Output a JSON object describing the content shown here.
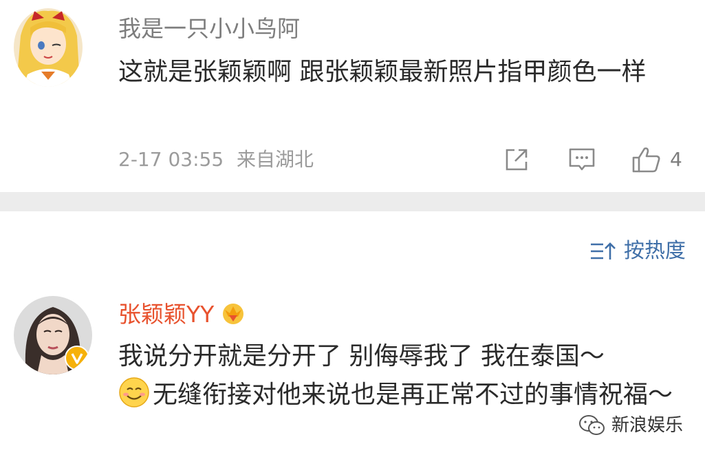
{
  "comments": [
    {
      "username": "我是一只小小鸟阿",
      "text": "这就是张颖颖啊 跟张颖颖最新照片指甲颜色一样",
      "time": "2-17 03:55",
      "location": "来自湖北",
      "like_count": "4",
      "avatar_icon": "anime-girl-avatar"
    },
    {
      "username": "张颖颖YY",
      "text_part1": "我说分开就是分开了 别侮辱我了 我在泰国～",
      "text_part2": "无缝衔接对他来说也是再正常不过的事情祝福～",
      "avatar_icon": "woman-photo-avatar",
      "badge_icon": "crown-vip-icon"
    }
  ],
  "sort": {
    "label": "按热度"
  },
  "watermark": {
    "text": "新浪娱乐"
  },
  "colors": {
    "username_gray": "#7d7d7d",
    "username_vip": "#e8522e",
    "link_blue": "#3f6fa8",
    "divider": "#ececec"
  }
}
